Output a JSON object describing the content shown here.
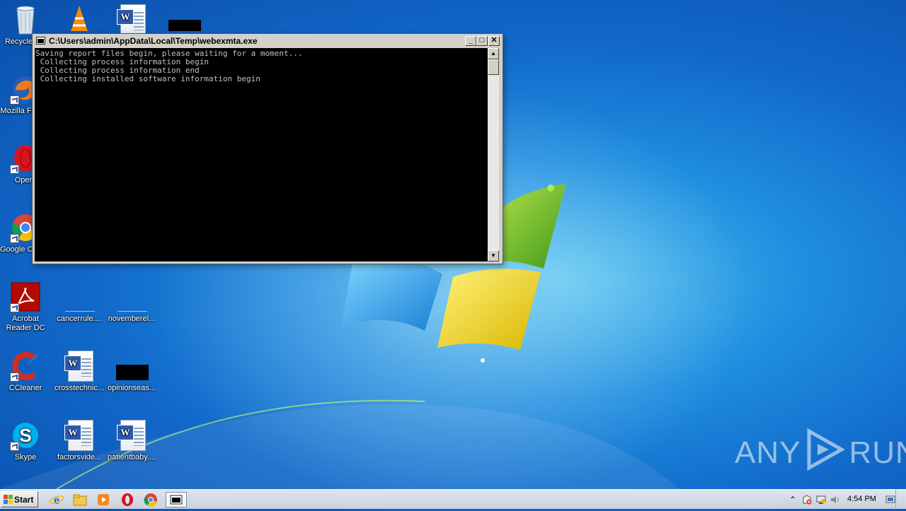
{
  "window": {
    "title": "C:\\Users\\admin\\AppData\\Local\\Temp\\webexmta.exe",
    "minimize": "_",
    "maximize": "□",
    "close": "✕",
    "console_lines": [
      "Saving report files begin, please waiting for a moment...",
      " Collecting process information begin",
      " Collecting process information end",
      " Collecting installed software information begin"
    ],
    "scroll_up": "▲",
    "scroll_down": "▼"
  },
  "desktop": {
    "icons": [
      {
        "label": "Recycle Bin",
        "icon": "recycle-bin-icon"
      },
      {
        "label": "Mozilla Firefox",
        "icon": "firefox-icon"
      },
      {
        "label": "Opera",
        "icon": "opera-icon"
      },
      {
        "label": "Google Chrome",
        "icon": "chrome-icon"
      },
      {
        "label": "Acrobat Reader DC",
        "icon": "acrobat-icon"
      },
      {
        "label": "CCleaner",
        "icon": "ccleaner-icon"
      },
      {
        "label": "Skype",
        "icon": "skype-icon"
      },
      {
        "label": "cancerrule....",
        "icon": "file-icon"
      },
      {
        "label": "novemberel...",
        "icon": "file-icon"
      },
      {
        "label": "crosstechnic...",
        "icon": "word-doc-icon"
      },
      {
        "label": "opinionseas...",
        "icon": "image-file-icon"
      },
      {
        "label": "factorsvide...",
        "icon": "word-doc-icon"
      },
      {
        "label": "patientbaby....",
        "icon": "word-doc-icon"
      }
    ]
  },
  "watermark": {
    "left": "ANY",
    "right": "RUN"
  },
  "taskbar": {
    "start_label": "Start",
    "pinned": [
      "ie-icon",
      "explorer-icon",
      "media-player-icon",
      "opera-icon",
      "chrome-icon",
      "console-icon"
    ],
    "tray_expand": "⌃",
    "clock": "4:54 PM"
  },
  "colors": {
    "wallpaper_mid": "#1f8fe0",
    "console_bg": "#000000",
    "console_text": "#c0c0c0",
    "chrome_face": "#d4d0c8"
  }
}
